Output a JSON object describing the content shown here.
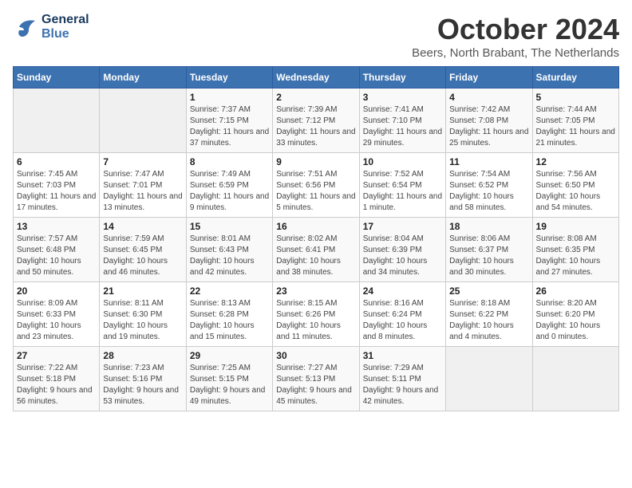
{
  "header": {
    "logo_line1": "General",
    "logo_line2": "Blue",
    "title": "October 2024",
    "subtitle": "Beers, North Brabant, The Netherlands"
  },
  "weekdays": [
    "Sunday",
    "Monday",
    "Tuesday",
    "Wednesday",
    "Thursday",
    "Friday",
    "Saturday"
  ],
  "weeks": [
    [
      {
        "day": "",
        "detail": ""
      },
      {
        "day": "",
        "detail": ""
      },
      {
        "day": "1",
        "detail": "Sunrise: 7:37 AM\nSunset: 7:15 PM\nDaylight: 11 hours and 37 minutes."
      },
      {
        "day": "2",
        "detail": "Sunrise: 7:39 AM\nSunset: 7:12 PM\nDaylight: 11 hours and 33 minutes."
      },
      {
        "day": "3",
        "detail": "Sunrise: 7:41 AM\nSunset: 7:10 PM\nDaylight: 11 hours and 29 minutes."
      },
      {
        "day": "4",
        "detail": "Sunrise: 7:42 AM\nSunset: 7:08 PM\nDaylight: 11 hours and 25 minutes."
      },
      {
        "day": "5",
        "detail": "Sunrise: 7:44 AM\nSunset: 7:05 PM\nDaylight: 11 hours and 21 minutes."
      }
    ],
    [
      {
        "day": "6",
        "detail": "Sunrise: 7:45 AM\nSunset: 7:03 PM\nDaylight: 11 hours and 17 minutes."
      },
      {
        "day": "7",
        "detail": "Sunrise: 7:47 AM\nSunset: 7:01 PM\nDaylight: 11 hours and 13 minutes."
      },
      {
        "day": "8",
        "detail": "Sunrise: 7:49 AM\nSunset: 6:59 PM\nDaylight: 11 hours and 9 minutes."
      },
      {
        "day": "9",
        "detail": "Sunrise: 7:51 AM\nSunset: 6:56 PM\nDaylight: 11 hours and 5 minutes."
      },
      {
        "day": "10",
        "detail": "Sunrise: 7:52 AM\nSunset: 6:54 PM\nDaylight: 11 hours and 1 minute."
      },
      {
        "day": "11",
        "detail": "Sunrise: 7:54 AM\nSunset: 6:52 PM\nDaylight: 10 hours and 58 minutes."
      },
      {
        "day": "12",
        "detail": "Sunrise: 7:56 AM\nSunset: 6:50 PM\nDaylight: 10 hours and 54 minutes."
      }
    ],
    [
      {
        "day": "13",
        "detail": "Sunrise: 7:57 AM\nSunset: 6:48 PM\nDaylight: 10 hours and 50 minutes."
      },
      {
        "day": "14",
        "detail": "Sunrise: 7:59 AM\nSunset: 6:45 PM\nDaylight: 10 hours and 46 minutes."
      },
      {
        "day": "15",
        "detail": "Sunrise: 8:01 AM\nSunset: 6:43 PM\nDaylight: 10 hours and 42 minutes."
      },
      {
        "day": "16",
        "detail": "Sunrise: 8:02 AM\nSunset: 6:41 PM\nDaylight: 10 hours and 38 minutes."
      },
      {
        "day": "17",
        "detail": "Sunrise: 8:04 AM\nSunset: 6:39 PM\nDaylight: 10 hours and 34 minutes."
      },
      {
        "day": "18",
        "detail": "Sunrise: 8:06 AM\nSunset: 6:37 PM\nDaylight: 10 hours and 30 minutes."
      },
      {
        "day": "19",
        "detail": "Sunrise: 8:08 AM\nSunset: 6:35 PM\nDaylight: 10 hours and 27 minutes."
      }
    ],
    [
      {
        "day": "20",
        "detail": "Sunrise: 8:09 AM\nSunset: 6:33 PM\nDaylight: 10 hours and 23 minutes."
      },
      {
        "day": "21",
        "detail": "Sunrise: 8:11 AM\nSunset: 6:30 PM\nDaylight: 10 hours and 19 minutes."
      },
      {
        "day": "22",
        "detail": "Sunrise: 8:13 AM\nSunset: 6:28 PM\nDaylight: 10 hours and 15 minutes."
      },
      {
        "day": "23",
        "detail": "Sunrise: 8:15 AM\nSunset: 6:26 PM\nDaylight: 10 hours and 11 minutes."
      },
      {
        "day": "24",
        "detail": "Sunrise: 8:16 AM\nSunset: 6:24 PM\nDaylight: 10 hours and 8 minutes."
      },
      {
        "day": "25",
        "detail": "Sunrise: 8:18 AM\nSunset: 6:22 PM\nDaylight: 10 hours and 4 minutes."
      },
      {
        "day": "26",
        "detail": "Sunrise: 8:20 AM\nSunset: 6:20 PM\nDaylight: 10 hours and 0 minutes."
      }
    ],
    [
      {
        "day": "27",
        "detail": "Sunrise: 7:22 AM\nSunset: 5:18 PM\nDaylight: 9 hours and 56 minutes."
      },
      {
        "day": "28",
        "detail": "Sunrise: 7:23 AM\nSunset: 5:16 PM\nDaylight: 9 hours and 53 minutes."
      },
      {
        "day": "29",
        "detail": "Sunrise: 7:25 AM\nSunset: 5:15 PM\nDaylight: 9 hours and 49 minutes."
      },
      {
        "day": "30",
        "detail": "Sunrise: 7:27 AM\nSunset: 5:13 PM\nDaylight: 9 hours and 45 minutes."
      },
      {
        "day": "31",
        "detail": "Sunrise: 7:29 AM\nSunset: 5:11 PM\nDaylight: 9 hours and 42 minutes."
      },
      {
        "day": "",
        "detail": ""
      },
      {
        "day": "",
        "detail": ""
      }
    ]
  ]
}
